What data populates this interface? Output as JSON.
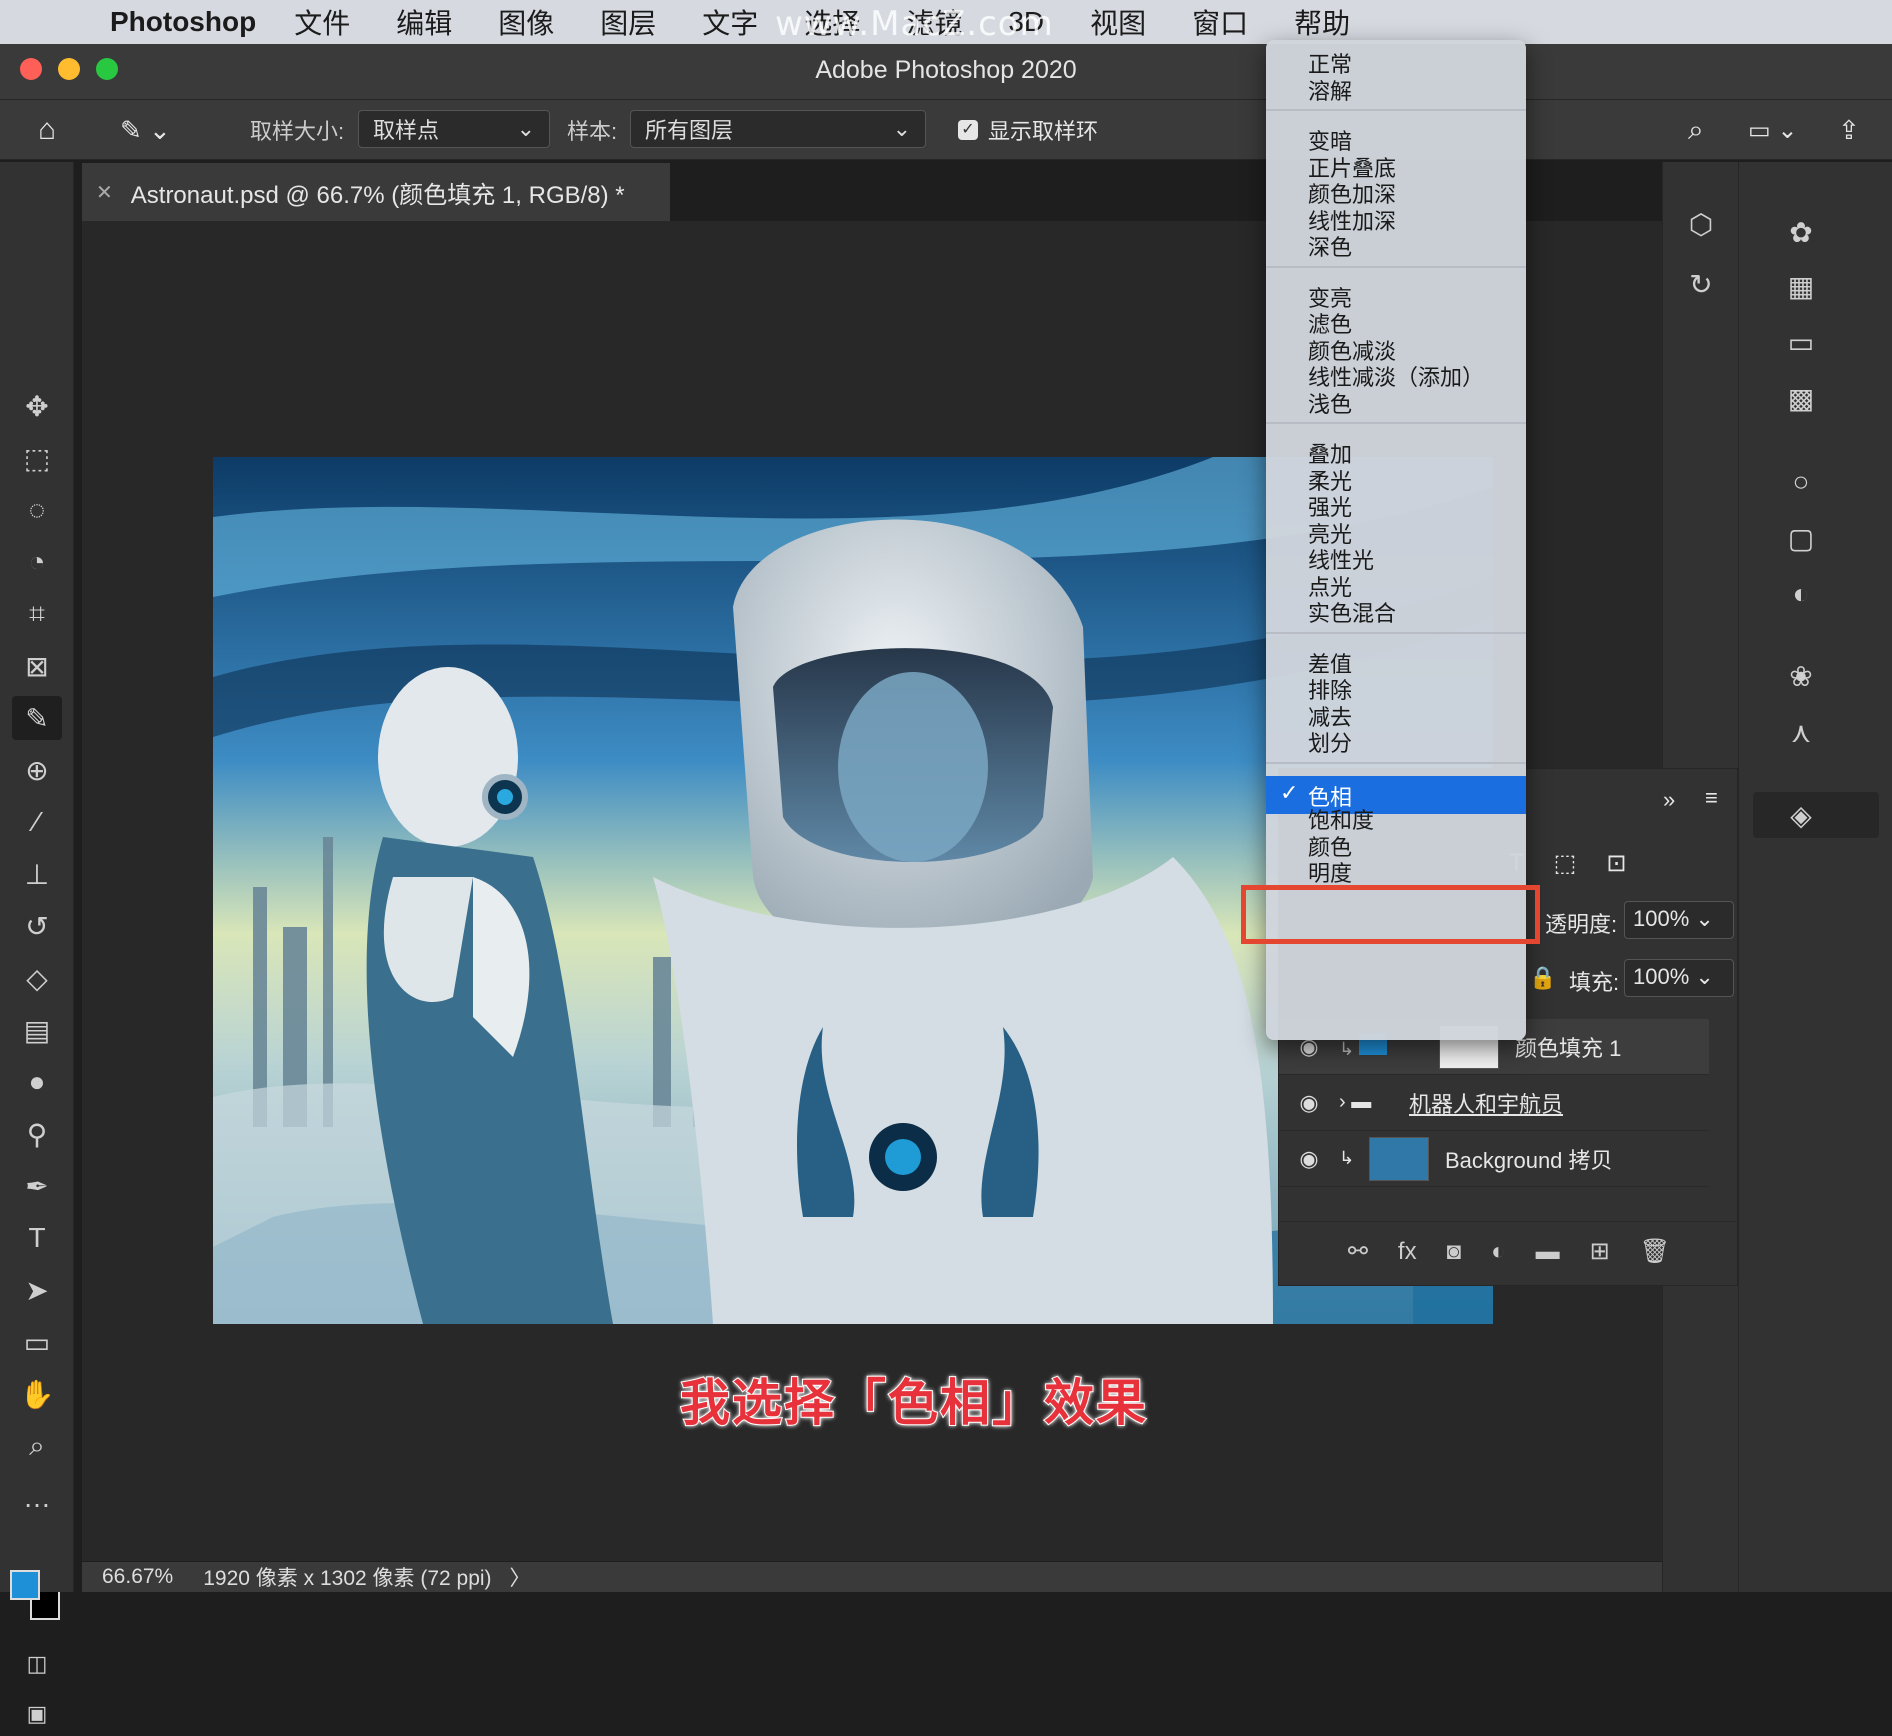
{
  "menubar": {
    "app_name": "Photoshop",
    "items": [
      "文件",
      "编辑",
      "图像",
      "图层",
      "文字",
      "选择",
      "滤镜",
      "3D",
      "视图",
      "窗口",
      "帮助"
    ],
    "watermark": "www.MacZ.com"
  },
  "window": {
    "title": "Adobe Photoshop 2020"
  },
  "options": {
    "sample_size_label": "取样大小:",
    "sample_size_value": "取样点",
    "sample_label": "样本:",
    "sample_value": "所有图层",
    "show_ring_label": "显示取样环"
  },
  "document": {
    "tab_title": "Astronaut.psd @ 66.7% (颜色填充 1, RGB/8) *"
  },
  "status": {
    "zoom": "66.67%",
    "dimensions": "1920 像素 x 1302 像素 (72 ppi)",
    "arrow": "〉"
  },
  "caption": "我选择「色相」效果",
  "blend_menu": {
    "groups": [
      [
        "正常",
        "溶解"
      ],
      [
        "变暗",
        "正片叠底",
        "颜色加深",
        "线性加深",
        "深色"
      ],
      [
        "变亮",
        "滤色",
        "颜色减淡",
        "线性减淡（添加）",
        "浅色"
      ],
      [
        "叠加",
        "柔光",
        "强光",
        "亮光",
        "线性光",
        "点光",
        "实色混合"
      ],
      [
        "差值",
        "排除",
        "减去",
        "划分"
      ],
      [
        "色相",
        "饱和度",
        "颜色",
        "明度"
      ]
    ],
    "selected": "色相",
    "checkmark": "✓"
  },
  "layers_panel": {
    "opacity_label": "透明度:",
    "opacity_value": "100%",
    "fill_label": "填充:",
    "fill_value": "100%",
    "layers": [
      {
        "name": "颜色填充 1"
      },
      {
        "name": "机器人和宇航员"
      },
      {
        "name": "Background 拷贝"
      }
    ]
  },
  "colors": {
    "accent": "#1a6ee0",
    "highlight_border": "#e4462f",
    "foreground": "#1e90d8",
    "background_swatch": "#000000",
    "layer_thumb": "#2f78a8"
  }
}
